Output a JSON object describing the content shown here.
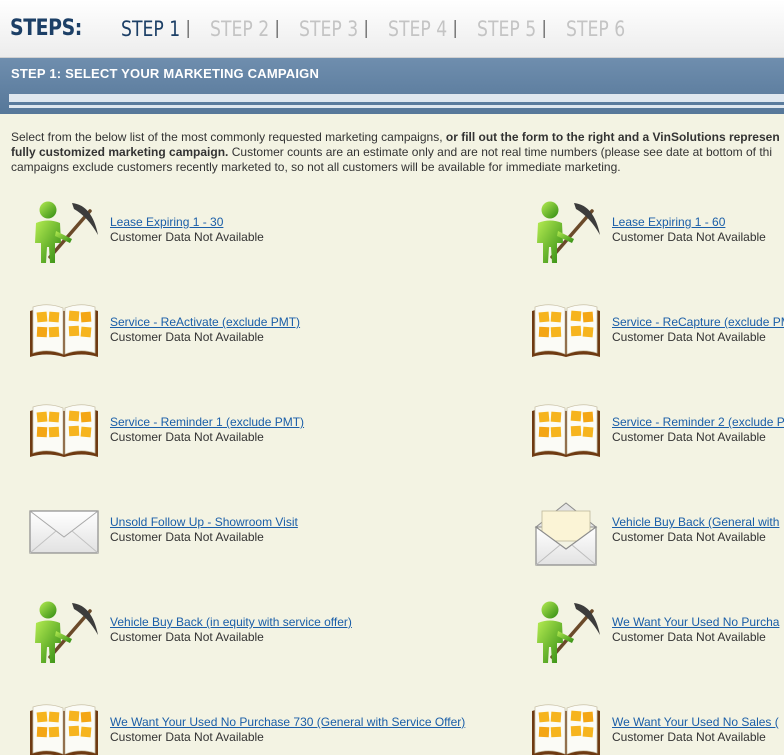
{
  "steps": {
    "label": "STEPS:",
    "items": [
      "STEP 1",
      "STEP 2",
      "STEP 3",
      "STEP 4",
      "STEP 5",
      "STEP 6"
    ],
    "separator": "|",
    "active_index": 0
  },
  "header": {
    "title": "STEP 1: SELECT YOUR MARKETING CAMPAIGN"
  },
  "intro": {
    "line1_a": "Select from the below list of the most commonly requested marketing campaigns, ",
    "line1_b": "or fill out the form to the right and a VinSolutions represen",
    "line2_a": "fully customized marketing campaign.",
    "line2_b": " Customer counts are an estimate only and are not real time numbers (please see date at bottom of thi",
    "line3": "campaigns exclude customers recently marketed to, so not all customers will be available for immediate marketing."
  },
  "campaigns": [
    {
      "title": "Lease Expiring 1 - 30",
      "status": "Customer Data Not Available",
      "icon": "pickaxe-person-icon"
    },
    {
      "title": "Lease Expiring 1 - 60",
      "status": "Customer Data Not Available",
      "icon": "pickaxe-person-icon"
    },
    {
      "title": "Service - ReActivate (exclude PMT)",
      "status": "Customer Data Not Available",
      "icon": "open-book-icon"
    },
    {
      "title": "Service - ReCapture (exclude PM",
      "status": "Customer Data Not Available",
      "icon": "open-book-icon"
    },
    {
      "title": "Service - Reminder 1 (exclude PMT)",
      "status": "Customer Data Not Available",
      "icon": "open-book-icon"
    },
    {
      "title": "Service - Reminder 2 (exclude P",
      "status": "Customer Data Not Available",
      "icon": "open-book-icon"
    },
    {
      "title": "Unsold Follow Up - Showroom Visit",
      "status": "Customer Data Not Available",
      "icon": "closed-envelope-icon"
    },
    {
      "title": "Vehicle Buy Back (General with",
      "status": "Customer Data Not Available",
      "icon": "open-envelope-icon"
    },
    {
      "title": "Vehicle Buy Back (in equity with service offer)",
      "status": "Customer Data Not Available",
      "icon": "pickaxe-person-icon"
    },
    {
      "title": "We Want Your Used No Purcha",
      "status": "Customer Data Not Available",
      "icon": "pickaxe-person-icon"
    },
    {
      "title": "We Want Your Used No Purchase 730 (General with Service Offer)",
      "status": "Customer Data Not Available",
      "icon": "open-book-icon"
    },
    {
      "title": "We Want Your Used No Sales (",
      "status": "Customer Data Not Available",
      "icon": "open-book-icon"
    }
  ]
}
